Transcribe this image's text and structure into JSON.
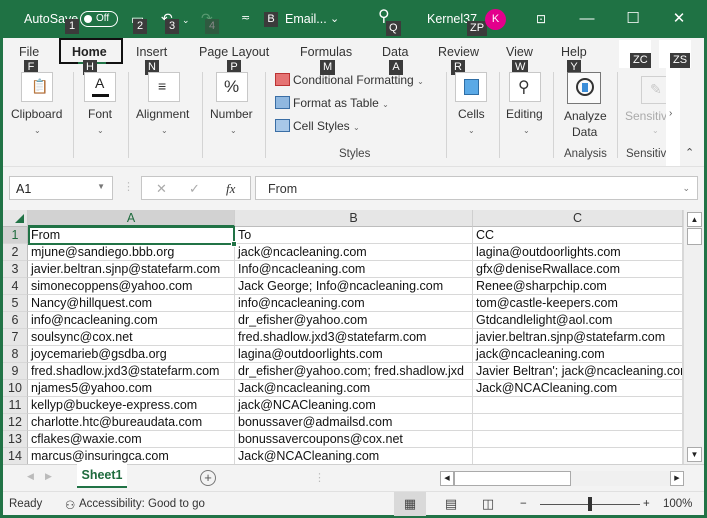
{
  "titlebar": {
    "autosave_label": "AutoSave",
    "autosave_state": "Off",
    "filename": "Email...",
    "user_name": "Kernel37",
    "avatar_initial": "K",
    "keytips": {
      "autosave": "1",
      "save": "2",
      "undo": "3",
      "redo": "4",
      "filename": "B",
      "search": "Q",
      "account": "ZP"
    }
  },
  "ribbon": {
    "tabs": [
      {
        "label": "File",
        "keytip": "F"
      },
      {
        "label": "Home",
        "keytip": "H",
        "active": true
      },
      {
        "label": "Insert",
        "keytip": "N"
      },
      {
        "label": "Page Layout",
        "keytip": "P"
      },
      {
        "label": "Formulas",
        "keytip": "M"
      },
      {
        "label": "Data",
        "keytip": "A"
      },
      {
        "label": "Review",
        "keytip": "R"
      },
      {
        "label": "View",
        "keytip": "W"
      },
      {
        "label": "Help",
        "keytip": "Y"
      }
    ],
    "corner_keytips": [
      "ZC",
      "ZS"
    ],
    "groups": {
      "clipboard": "Clipboard",
      "font": "Font",
      "alignment": "Alignment",
      "number": "Number",
      "conditional_formatting": "Conditional Formatting",
      "format_as_table": "Format as Table",
      "cell_styles": "Cell Styles",
      "styles_group": "Styles",
      "cells": "Cells",
      "editing": "Editing",
      "analyze_data_line1": "Analyze",
      "analyze_data_line2": "Data",
      "analysis_group": "Analysis",
      "sensitivity": "Sensitiv",
      "sensitivity_group": "Sensitiv"
    }
  },
  "formula_bar": {
    "name_box": "A1",
    "cancel": "✕",
    "enter": "✓",
    "fx": "fx",
    "value": "From"
  },
  "sheet": {
    "columns": [
      "A",
      "B",
      "C"
    ],
    "rows": [
      {
        "n": "1",
        "cells": [
          "From",
          "To",
          "CC"
        ]
      },
      {
        "n": "2",
        "cells": [
          "mjune@sandiego.bbb.org",
          "jack@ncacleaning.com",
          "lagina@outdoorlights.com"
        ]
      },
      {
        "n": "3",
        "cells": [
          "javier.beltran.sjnp@statefarm.com",
          "Info@ncacleaning.com",
          "gfx@deniseRwallace.com"
        ]
      },
      {
        "n": "4",
        "cells": [
          "simonecoppens@yahoo.com",
          "Jack George; Info@ncacleaning.com",
          "Renee@sharpchip.com"
        ]
      },
      {
        "n": "5",
        "cells": [
          "Nancy@hillquest.com",
          "info@ncacleaning.com",
          "tom@castle-keepers.com"
        ]
      },
      {
        "n": "6",
        "cells": [
          "info@ncacleaning.com",
          "dr_efisher@yahoo.com",
          "Gtdcandlelight@aol.com"
        ]
      },
      {
        "n": "7",
        "cells": [
          "soulsync@cox.net",
          "fred.shadlow.jxd3@statefarm.com",
          "javier.beltran.sjnp@statefarm.com"
        ]
      },
      {
        "n": "8",
        "cells": [
          "joycemarieb@gsdba.org",
          "lagina@outdoorlights.com",
          "jack@ncacleaning.com"
        ]
      },
      {
        "n": "9",
        "cells": [
          "fred.shadlow.jxd3@statefarm.com",
          "dr_efisher@yahoo.com; fred.shadlow.jxd",
          "Javier Beltran'; jack@ncacleaning.com"
        ]
      },
      {
        "n": "10",
        "cells": [
          "njames5@yahoo.com",
          "Jack@ncacleaning.com",
          "Jack@NCACleaning.com"
        ]
      },
      {
        "n": "11",
        "cells": [
          "kellyp@buckeye-express.com",
          "jack@NCACleaning.com",
          ""
        ]
      },
      {
        "n": "12",
        "cells": [
          "charlotte.htc@bureaudata.com",
          "bonussaver@admailsd.com",
          ""
        ]
      },
      {
        "n": "13",
        "cells": [
          "cflakes@waxie.com",
          "bonussavercoupons@cox.net",
          ""
        ]
      },
      {
        "n": "14",
        "cells": [
          "marcus@insuringca.com",
          "Jack@NCACleaning.com",
          ""
        ]
      }
    ],
    "sheet_tab": "Sheet1",
    "add_sheet": "+"
  },
  "statusbar": {
    "ready": "Ready",
    "accessibility": "Accessibility: Good to go",
    "zoom_minus": "−",
    "zoom_plus": "+",
    "zoom_level": "100%",
    "zoom_percent_value": 100
  },
  "colors": {
    "accent": "#217346",
    "titlebar": "#1f7244",
    "avatar": "#e3008c"
  }
}
